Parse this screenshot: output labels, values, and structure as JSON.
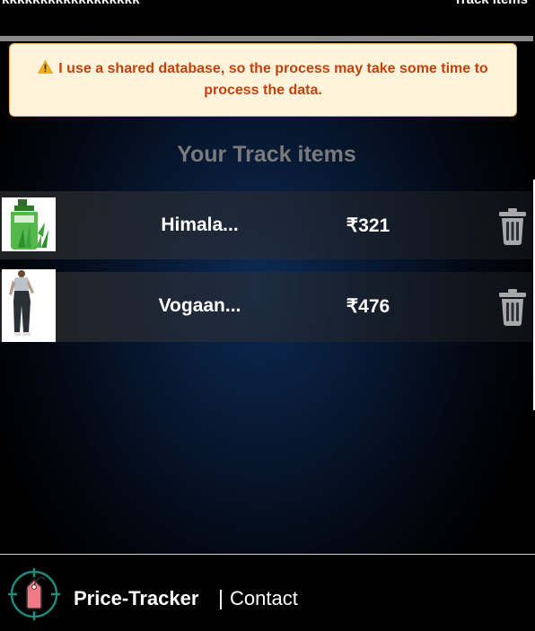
{
  "header": {
    "brand": "kkkkkkkkkkkkkkkkkk",
    "nav_link": "Track items"
  },
  "notice": {
    "icon": "warning-icon",
    "text": "I use a shared database, so the process may take some time to process the data."
  },
  "section": {
    "title": "Your Track items"
  },
  "items": [
    {
      "name": "Himala...",
      "price": "₹321",
      "delete_icon": "trash-icon"
    },
    {
      "name": "Vogaan...",
      "price": "₹476",
      "delete_icon": "trash-icon"
    }
  ],
  "footer": {
    "app_name": "Price-Tracker",
    "separator": "|",
    "contact": "Contact",
    "logo_icon": "price-tag-target-icon"
  },
  "colors": {
    "notice_bg": "#fff3dc",
    "notice_text": "#c2410c",
    "title_gray": "#7a7a7a",
    "trash_gray": "#a8a8a8",
    "logo_teal": "#1f8a7a",
    "tag_pink": "#f07a86"
  }
}
